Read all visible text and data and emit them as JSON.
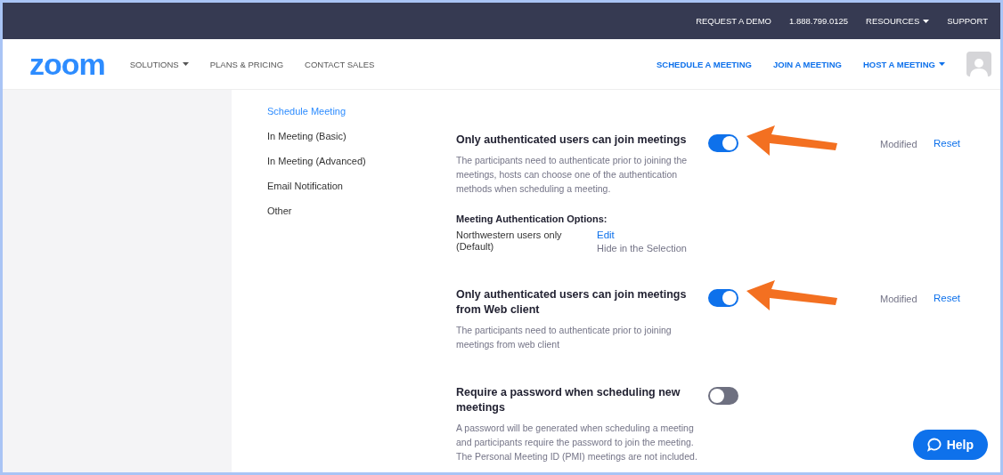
{
  "top_bar": {
    "links": [
      {
        "label": "REQUEST A DEMO",
        "dropdown": false
      },
      {
        "label": "1.888.799.0125",
        "dropdown": false
      },
      {
        "label": "RESOURCES",
        "dropdown": true
      },
      {
        "label": "SUPPORT",
        "dropdown": false
      }
    ]
  },
  "nav": {
    "logo": "zoom",
    "left_links": [
      {
        "label": "SOLUTIONS",
        "dropdown": true
      },
      {
        "label": "PLANS & PRICING",
        "dropdown": false
      },
      {
        "label": "CONTACT SALES",
        "dropdown": false
      }
    ],
    "right_links": [
      {
        "label": "SCHEDULE A MEETING",
        "dropdown": false
      },
      {
        "label": "JOIN A MEETING",
        "dropdown": false
      },
      {
        "label": "HOST A MEETING",
        "dropdown": true
      }
    ]
  },
  "sidebar": {
    "items": [
      {
        "label": "Schedule Meeting",
        "selected": true
      },
      {
        "label": "In Meeting (Basic)",
        "selected": false
      },
      {
        "label": "In Meeting (Advanced)",
        "selected": false
      },
      {
        "label": "Email Notification",
        "selected": false
      },
      {
        "label": "Other",
        "selected": false
      }
    ]
  },
  "settings": [
    {
      "title": "Only authenticated users can join meetings",
      "description": "The participants need to authenticate prior to joining the meetings, hosts can choose one of the authentication methods when scheduling a meeting.",
      "on": true,
      "highlighted": true,
      "status": "Modified",
      "action": "Reset",
      "options": {
        "heading": "Meeting Authentication Options:",
        "items": [
          {
            "name": "Northwestern users only (Default)",
            "link": "Edit",
            "note": "Hide in the Selection"
          }
        ]
      }
    },
    {
      "title": "Only authenticated users can join meetings from Web client",
      "description": "The participants need to authenticate prior to joining meetings from web client",
      "on": true,
      "highlighted": true,
      "status": "Modified",
      "action": "Reset"
    },
    {
      "title": "Require a password when scheduling new meetings",
      "description": "A password will be generated when scheduling a meeting and participants require the password to join the meeting. The Personal Meeting ID (PMI) meetings are not included.",
      "on": false,
      "highlighted": false
    }
  ],
  "help_button": {
    "label": "Help"
  }
}
